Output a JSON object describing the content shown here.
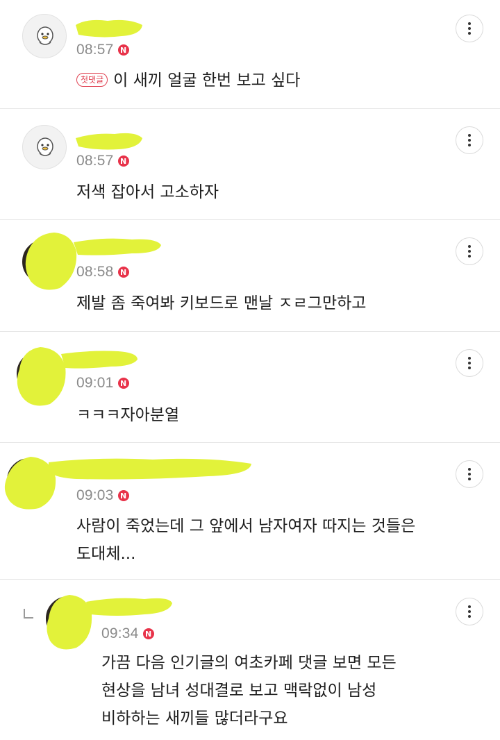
{
  "comments": [
    {
      "time": "08:57",
      "new_badge": "N",
      "first_badge": "첫댓글",
      "text_lines": [
        "이 새끼 얼굴 한번 보고 싶다"
      ],
      "avatar": "default-character-avatar"
    },
    {
      "time": "08:57",
      "new_badge": "N",
      "text_lines": [
        "저색 잡아서 고소하자"
      ],
      "avatar": "default-character-avatar"
    },
    {
      "time": "08:58",
      "new_badge": "N",
      "text_lines": [
        "제발 좀 죽여봐 키보드로 맨날 ㅈㄹ그만하고"
      ],
      "avatar": "photo-avatar"
    },
    {
      "time": "09:01",
      "new_badge": "N",
      "text_lines": [
        "ㅋㅋㅋ자아분열"
      ],
      "avatar": "photo-avatar"
    },
    {
      "time": "09:03",
      "new_badge": "N",
      "text_lines": [
        "사람이 죽었는데 그 앞에서 남자여자 따지는 것들은",
        "도대체..."
      ],
      "avatar": "photo-avatar"
    },
    {
      "time": "09:34",
      "new_badge": "N",
      "is_reply": true,
      "text_lines": [
        "가끔 다음 인기글의 여초카페 댓글 보면 모든",
        "현상을 남녀 성대결로 보고 맥락없이 남성",
        "비하하는 새끼들 많더라구요"
      ],
      "avatar": "photo-avatar"
    }
  ],
  "icons": {
    "more": "more-vertical-icon",
    "reply": "reply-arrow-icon"
  },
  "colors": {
    "redaction": "#e2f23a",
    "new_badge": "#e8334a",
    "time": "#8a8a8a"
  }
}
